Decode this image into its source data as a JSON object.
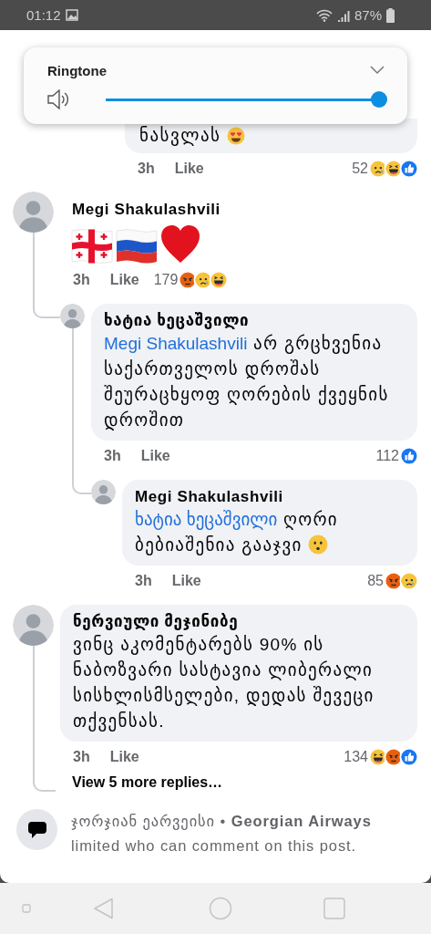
{
  "status_bar": {
    "time": "01:12",
    "battery": "87%"
  },
  "volume_popup": {
    "title": "Ringtone",
    "level": 1
  },
  "partial_reply": {
    "text": "ნასვლას",
    "emoji": {
      "kind": "heart_eyes"
    },
    "time": "3h",
    "like": "Like",
    "count": "52",
    "reactions": [
      {
        "kind": "sad"
      },
      {
        "kind": "haha"
      },
      {
        "kind": "like"
      }
    ]
  },
  "comments": [
    {
      "kind": "emoji",
      "author": "Megi Shakulashvili",
      "emojis": [
        {
          "kind": "georgia_flag"
        },
        {
          "kind": "russia_flag"
        },
        {
          "kind": "heart"
        }
      ],
      "time": "3h",
      "like": "Like",
      "count": "179",
      "reactions": [
        {
          "kind": "angry"
        },
        {
          "kind": "sad"
        },
        {
          "kind": "haha"
        }
      ],
      "children": [
        {
          "kind": "text",
          "author": "ხატია ხეცაშვილი",
          "mention": "Megi Shakulashvili",
          "text": "არ გრცხვენია საქართველოს დროშას შეურაცხყოფ ღორების ქვეყნის დროშით",
          "time": "3h",
          "like": "Like",
          "count": "112",
          "reactions": [
            {
              "kind": "like"
            }
          ],
          "children": [
            {
              "kind": "text",
              "author": "Megi Shakulashvili",
              "mention": "ხატია ხეცაშვილი",
              "text": "ღორი ბებიაშენია გააჯვი",
              "emoji": {
                "kind": "kissing"
              },
              "time": "3h",
              "like": "Like",
              "count": "85",
              "reactions": [
                {
                  "kind": "angry"
                },
                {
                  "kind": "sad"
                }
              ]
            }
          ]
        }
      ]
    },
    {
      "kind": "text",
      "author": "ნერვიული მეჯინიბე",
      "text": "ვინც აკომენტარებს 90% ის ნაბოზვარი სასტავია  ლიბერალი სისხლისმსელები, დედას შევეცი თქვენსას.",
      "time": "3h",
      "like": "Like",
      "count": "134",
      "reactions": [
        {
          "kind": "haha"
        },
        {
          "kind": "angry"
        },
        {
          "kind": "like"
        }
      ],
      "more_replies": "View 5 more replies…"
    }
  ],
  "footer": {
    "text": "ჯორჯიან ეარვეისი • **Georgian Airways** limited who can comment on this post."
  }
}
